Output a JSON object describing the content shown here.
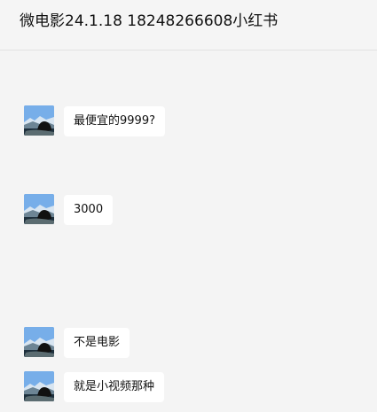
{
  "app": {
    "chat_title": "微电影24.1.18 18248266608小红书"
  },
  "messages": [
    {
      "sender_avatar": "landscape-photo-icon",
      "text": "最便宜的9999?"
    },
    {
      "sender_avatar": "landscape-photo-icon",
      "text": "3000"
    },
    {
      "sender_avatar": "landscape-photo-icon",
      "text": "不是电影"
    },
    {
      "sender_avatar": "landscape-photo-icon",
      "text": "就是小视频那种"
    }
  ],
  "colors": {
    "background": "#f4f4f4",
    "bubble": "#ffffff",
    "header_border": "#e2e2e2",
    "text": "#111111"
  }
}
